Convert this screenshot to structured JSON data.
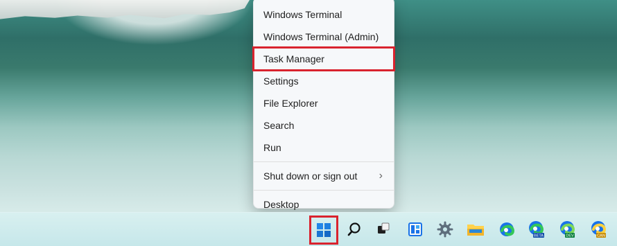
{
  "desktop": {
    "context_menu": {
      "items": [
        {
          "label": "Windows Terminal"
        },
        {
          "label": "Windows Terminal (Admin)"
        },
        {
          "label": "Task Manager",
          "highlighted": true
        },
        {
          "label": "Settings"
        },
        {
          "label": "File Explorer"
        },
        {
          "label": "Search"
        },
        {
          "label": "Run"
        },
        {
          "label": "Shut down or sign out",
          "has_submenu": true
        },
        {
          "label": "Desktop"
        }
      ],
      "submenu_glyph": "›"
    }
  },
  "taskbar": {
    "icons": [
      {
        "name": "start-button",
        "icon": "windows-logo"
      },
      {
        "name": "search-button",
        "icon": "search"
      },
      {
        "name": "task-view-button",
        "icon": "task-view"
      },
      {
        "name": "widgets-button",
        "icon": "widgets"
      },
      {
        "name": "settings-button",
        "icon": "gear"
      },
      {
        "name": "file-explorer-button",
        "icon": "folder"
      },
      {
        "name": "edge-button",
        "icon": "edge"
      },
      {
        "name": "edge-beta-button",
        "icon": "edge-beta",
        "badge": "BETA"
      },
      {
        "name": "edge-dev-button",
        "icon": "edge-dev",
        "badge": "DEV"
      },
      {
        "name": "edge-canary-button",
        "icon": "edge-canary",
        "badge": "CAN"
      }
    ]
  },
  "colors": {
    "highlight": "#d9232e",
    "menu_bg": "#f6f8fa",
    "taskbar_bg": "#c6e7ea",
    "windows_blue": "#1a73e8"
  }
}
